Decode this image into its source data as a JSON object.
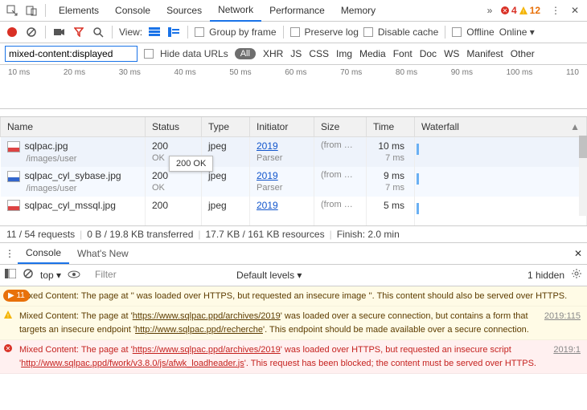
{
  "topbar": {
    "tabs": [
      "Elements",
      "Console",
      "Sources",
      "Network",
      "Performance",
      "Memory"
    ],
    "active": 3,
    "errors": "4",
    "warnings": "12"
  },
  "toolbar": {
    "view": "View:",
    "group": "Group by frame",
    "preserve": "Preserve log",
    "disable": "Disable cache",
    "offline": "Offline",
    "online": "Online"
  },
  "filter": {
    "value": "mixed-content:displayed",
    "hide": "Hide data URLs",
    "types": [
      "All",
      "XHR",
      "JS",
      "CSS",
      "Img",
      "Media",
      "Font",
      "Doc",
      "WS",
      "Manifest",
      "Other"
    ]
  },
  "timeline": {
    "ticks": [
      "10 ms",
      "20 ms",
      "30 ms",
      "40 ms",
      "50 ms",
      "60 ms",
      "70 ms",
      "80 ms",
      "90 ms",
      "100 ms",
      "110"
    ]
  },
  "columns": [
    "Name",
    "Status",
    "Type",
    "Initiator",
    "Size",
    "Time",
    "Waterfall"
  ],
  "rows": [
    {
      "name": "sqlpac.jpg",
      "path": "/images/user",
      "status": "200",
      "statusText": "OK",
      "type": "jpeg",
      "init": "2019",
      "initSub": "Parser",
      "size": "(from …",
      "time": "10 ms",
      "timeSub": "7 ms",
      "icon": "red"
    },
    {
      "name": "sqlpac_cyl_sybase.jpg",
      "path": "/images/user",
      "status": "200",
      "statusText": "OK",
      "type": "jpeg",
      "init": "2019",
      "initSub": "Parser",
      "size": "(from …",
      "time": "9 ms",
      "timeSub": "7 ms",
      "icon": "blue"
    },
    {
      "name": "sqlpac_cyl_mssql.jpg",
      "path": "",
      "status": "200",
      "statusText": "",
      "type": "jpeg",
      "init": "2019",
      "initSub": "",
      "size": "(from …",
      "time": "5 ms",
      "timeSub": "",
      "icon": "red"
    }
  ],
  "tooltip": "200 OK",
  "summary": {
    "requests": "11 / 54 requests",
    "transferred": "0 B / 19.8 KB transferred",
    "resources": "17.7 KB / 161 KB resources",
    "finish": "Finish: 2.0 min"
  },
  "drawer": {
    "tabs": [
      "Console",
      "What's New"
    ],
    "active": 0
  },
  "consoleToolbar": {
    "context": "top",
    "filter_placeholder": "Filter",
    "levels": "Default levels",
    "hidden": "1 hidden",
    "badge": "11"
  },
  "messages": [
    {
      "type": "warn",
      "badge": "chip",
      "text": "Mixed Content: The page at '<URL>' was loaded over HTTPS, but requested an insecure image '<URL>'. This content should also be served over HTTPS.",
      "src": ""
    },
    {
      "type": "warn2",
      "badge": "warn",
      "text": "Mixed Content: The page at 'https://www.sqlpac.ppd/archives/2019' was loaded over a secure connection, but contains a form that targets an insecure endpoint 'http://www.sqlpac.ppd/recherche'. This endpoint should be made available over a secure connection.",
      "src": "2019:115"
    },
    {
      "type": "err",
      "badge": "err",
      "text": "Mixed Content: The page at 'https://www.sqlpac.ppd/archives/2019' was loaded over HTTPS, but requested an insecure script 'http://www.sqlpac.ppd/fwork/v3.8.0/js/afwk_loadheader.js'. This request has been blocked; the content must be served over HTTPS.",
      "src": "2019:1"
    }
  ]
}
